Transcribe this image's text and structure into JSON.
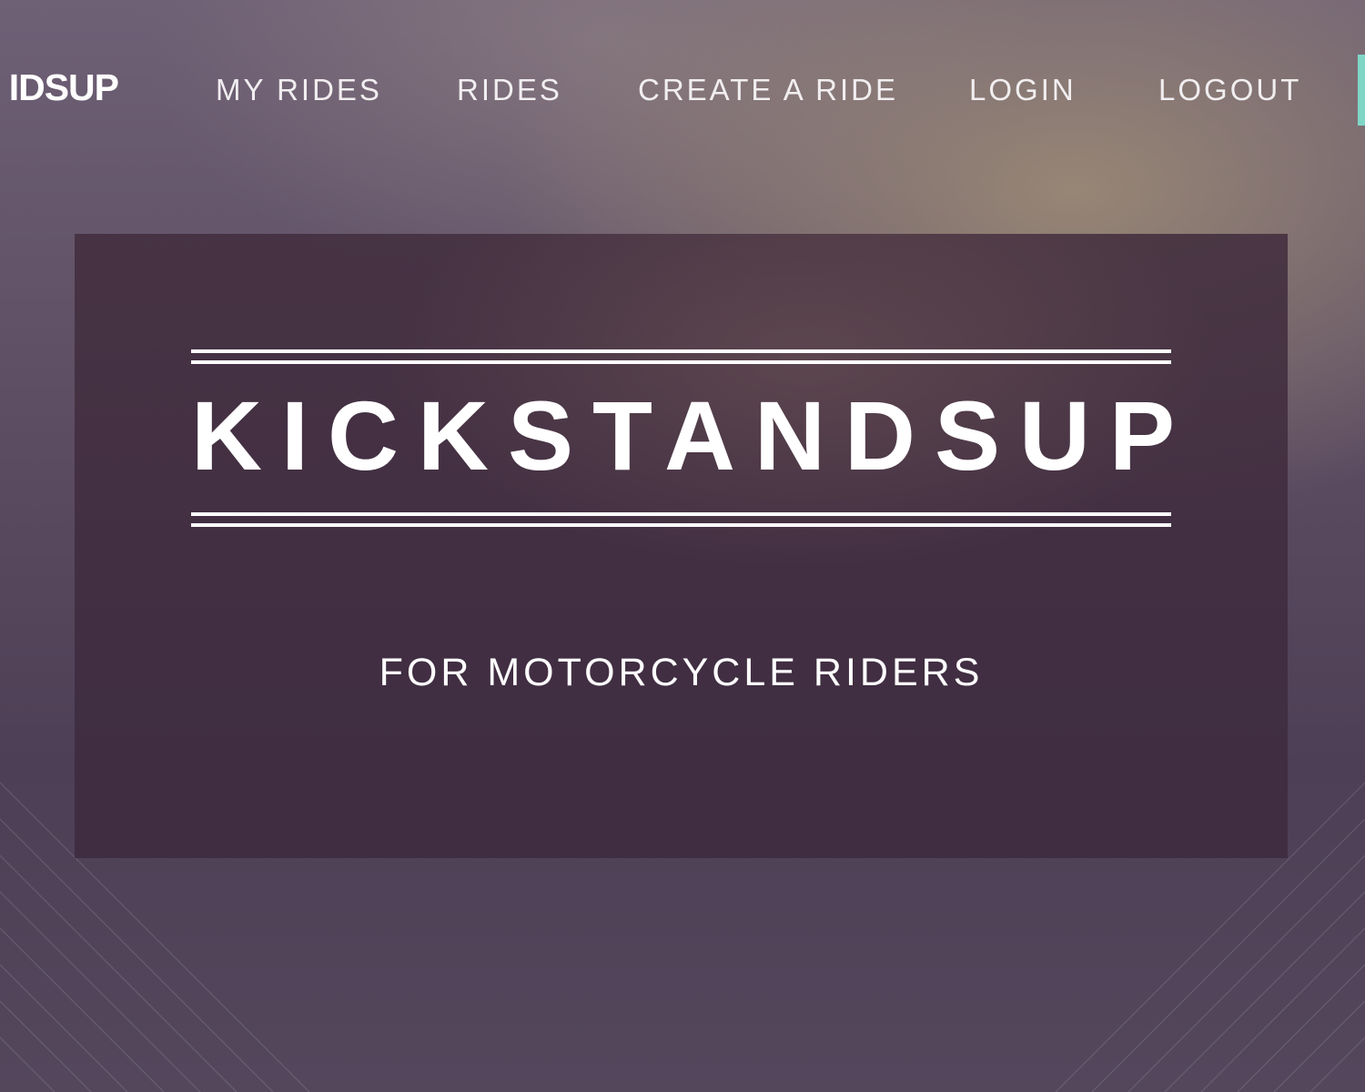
{
  "nav": {
    "brand": "IDSUP",
    "items": [
      {
        "label": "MY RIDES"
      },
      {
        "label": "RIDES"
      },
      {
        "label": "CREATE A RIDE"
      },
      {
        "label": "LOGIN"
      },
      {
        "label": "LOGOUT"
      }
    ],
    "accent_color": "#7fd6c6"
  },
  "hero": {
    "title": "KICKSTANDSUP",
    "tagline": "FOR MOTORCYCLE RIDERS"
  }
}
